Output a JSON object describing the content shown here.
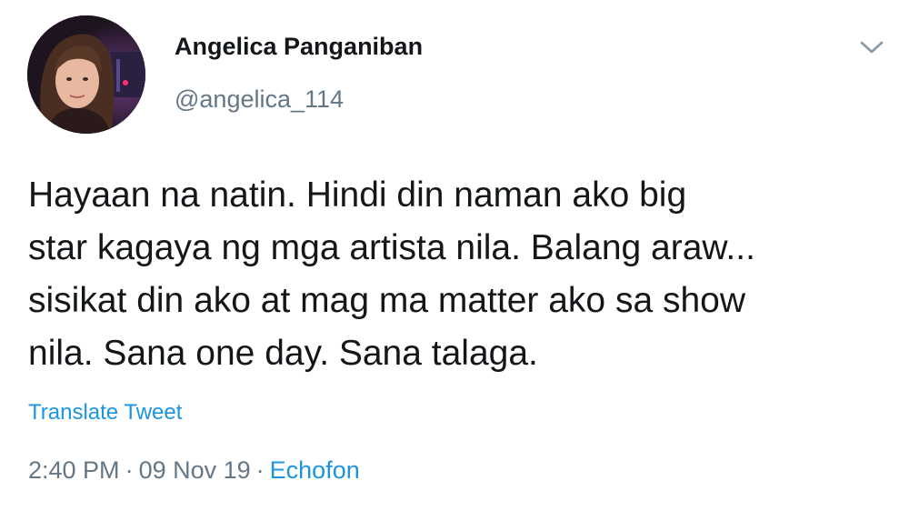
{
  "user": {
    "display_name": "Angelica Panganiban",
    "handle": "@angelica_114",
    "avatar_icon": "profile-photo"
  },
  "menu": {
    "icon": "chevron-down-icon"
  },
  "tweet": {
    "text_lines": [
      "Hayaan na natin. Hindi din naman ako big",
      "star kagaya ng mga artista nila. Balang araw...",
      "sisikat din ako at mag ma matter ako sa show",
      "nila. Sana one day. Sana talaga."
    ],
    "translate_label": "Translate Tweet",
    "time": "2:40 PM",
    "date": "09 Nov 19",
    "separator": "·",
    "source": "Echofon"
  },
  "colors": {
    "text": "#14171a",
    "secondary": "#657786",
    "link": "#1b95e0"
  }
}
